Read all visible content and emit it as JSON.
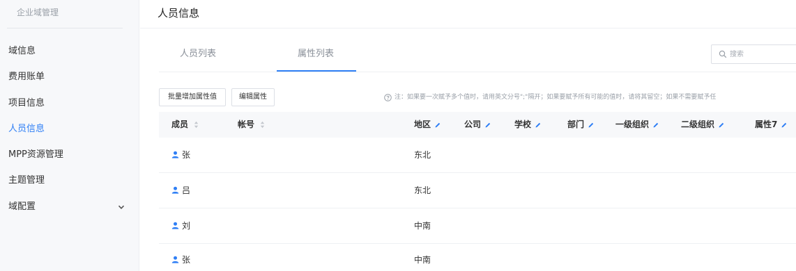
{
  "sidebar": {
    "brand": "企业域管理",
    "items": [
      {
        "label": "域信息"
      },
      {
        "label": "费用账单"
      },
      {
        "label": "项目信息"
      },
      {
        "label": "人员信息",
        "active": true
      },
      {
        "label": "MPP资源管理"
      },
      {
        "label": "主题管理"
      },
      {
        "label": "域配置",
        "expandable": true
      }
    ]
  },
  "page": {
    "title": "人员信息"
  },
  "tabs": [
    {
      "label": "人员列表"
    },
    {
      "label": "属性列表",
      "selected": true
    }
  ],
  "search": {
    "placeholder": "搜索",
    "value": ""
  },
  "toolbar": {
    "batch_add_label": "批量增加属性值",
    "edit_attr_label": "编辑属性",
    "note": "注：如果要一次赋予多个值时，请用英文分号\";\"隔开；如果要赋予所有可能的值时，请将其留空；如果不需要赋予任"
  },
  "table": {
    "columns": [
      "成员",
      "帐号",
      "地区",
      "公司",
      "学校",
      "部门",
      "一级组织",
      "二级组织",
      "属性7"
    ],
    "rows": [
      {
        "member": "张",
        "account": "",
        "region": "东北"
      },
      {
        "member": "吕",
        "account": "",
        "region": "东北"
      },
      {
        "member": "刘",
        "account": "",
        "region": "中南"
      },
      {
        "member": "张",
        "account": "",
        "region": "中南"
      }
    ]
  },
  "colors": {
    "accent": "#2f7ff5",
    "sidebar_bg": "#f7f8fa",
    "header_bg": "#f7f8fa"
  },
  "icons": [
    "search-icon",
    "help-icon",
    "sort-icon",
    "edit-pencil-icon",
    "user-icon",
    "chevron-down-icon"
  ]
}
